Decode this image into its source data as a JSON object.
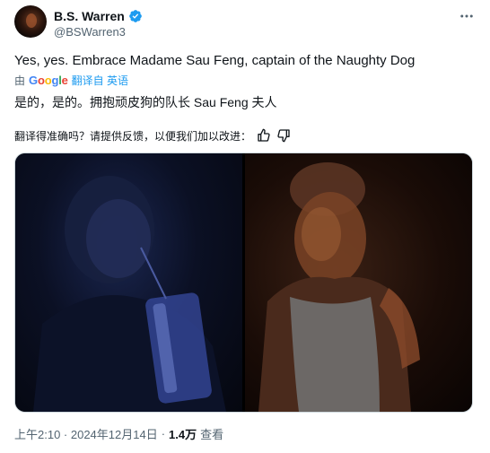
{
  "author": {
    "display_name": "B.S. Warren",
    "handle": "@BSWarren3"
  },
  "tweet": {
    "text": "Yes, yes. Embrace Madame Sau Feng, captain of the Naughty Dog"
  },
  "translation": {
    "by_label": "由",
    "provider_logo": [
      "G",
      "o",
      "o",
      "g",
      "l",
      "e"
    ],
    "link": "翻译自 英语",
    "text": "是的，是的。拥抱顽皮狗的队长 Sau Feng 夫人",
    "feedback_prompt": "翻译得准确吗？请提供反馈，以便我们加以改进："
  },
  "meta": {
    "timestamp": "上午2:10 · 2024年12月14日",
    "separator": "·",
    "views_count": "1.4万",
    "views_label": "查看"
  },
  "icons": {
    "verified": "verified-badge-icon",
    "more": "more-icon",
    "thumbs_up": "thumbs-up-icon",
    "thumbs_down": "thumbs-down-icon"
  },
  "colors": {
    "accent": "#1d9bf0",
    "secondary_text": "#536471"
  }
}
